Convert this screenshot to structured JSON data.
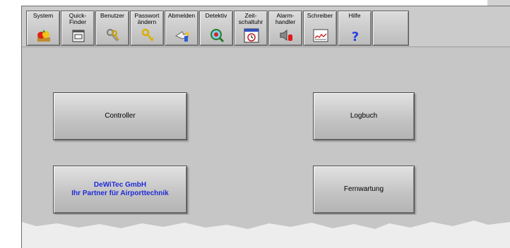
{
  "toolbar": {
    "items": [
      {
        "label": "System",
        "icon": "fruit-icon"
      },
      {
        "label": "Quick-\nFinder",
        "icon": "finder-window-icon"
      },
      {
        "label": "Benutzer",
        "icon": "keys-icon"
      },
      {
        "label": "Passwort\nändern",
        "icon": "key-icon"
      },
      {
        "label": "Abmelden",
        "icon": "logout-hand-icon"
      },
      {
        "label": "Detektiv",
        "icon": "magnifier-icon"
      },
      {
        "label": "Zeit-\nschaltuhr",
        "icon": "calendar-clock-icon"
      },
      {
        "label": "Alarm-\nhandler",
        "icon": "alarm-speaker-icon"
      },
      {
        "label": "Schreiber",
        "icon": "chart-recorder-icon"
      },
      {
        "label": "Hilfe",
        "icon": "question-mark-icon"
      }
    ]
  },
  "main": {
    "controller_label": "Controller",
    "logbuch_label": "Logbuch",
    "company_line1": "DeWiTec GmbH",
    "company_line2": "Ihr Partner für Airporttechnik",
    "fernwartung_label": "Fernwartung"
  },
  "colors": {
    "background": "#c6c6c6",
    "company_text": "#1f2bd6"
  }
}
